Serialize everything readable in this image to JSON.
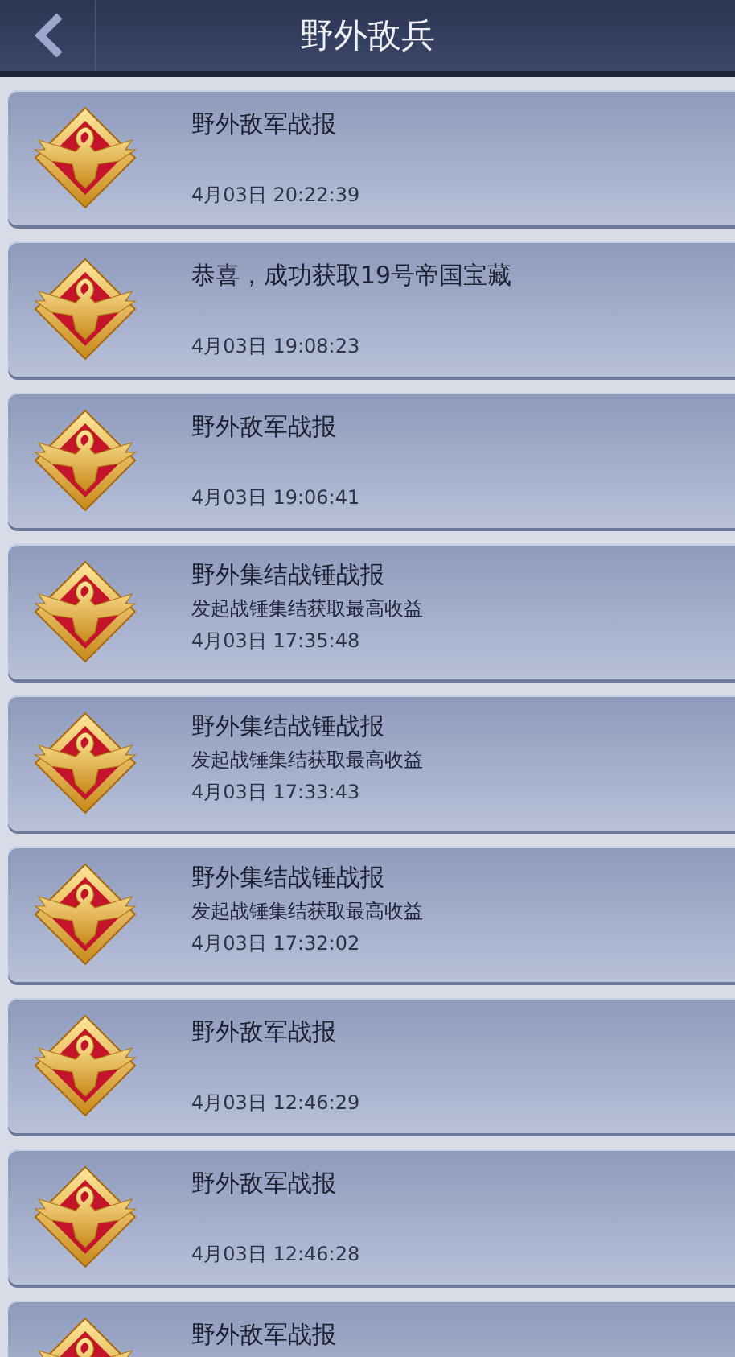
{
  "header": {
    "title": "野外敌兵"
  },
  "reports": [
    {
      "title": "野外敌军战报",
      "time": "4月03日 20:22:39"
    },
    {
      "title": "恭喜，成功获取19号帝国宝藏",
      "time": "4月03日 19:08:23"
    },
    {
      "title": "野外敌军战报",
      "time": "4月03日 19:06:41"
    },
    {
      "title": "野外集结战锤战报",
      "subtitle": "发起战锤集结获取最高收益",
      "time": "4月03日 17:35:48"
    },
    {
      "title": "野外集结战锤战报",
      "subtitle": "发起战锤集结获取最高收益",
      "time": "4月03日 17:33:43"
    },
    {
      "title": "野外集结战锤战报",
      "subtitle": "发起战锤集结获取最高收益",
      "time": "4月03日 17:32:02"
    },
    {
      "title": "野外敌军战报",
      "time": "4月03日 12:46:29"
    },
    {
      "title": "野外敌军战报",
      "time": "4月03日 12:46:28"
    },
    {
      "title": "野外敌军战报"
    }
  ]
}
